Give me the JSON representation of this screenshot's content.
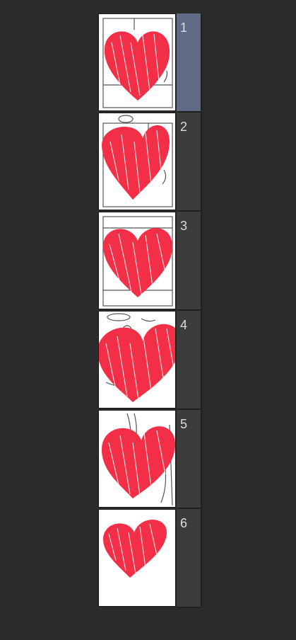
{
  "pages": [
    {
      "number": "1",
      "selected": true,
      "icon": "heart-sketch"
    },
    {
      "number": "2",
      "selected": false,
      "icon": "heart-sketch"
    },
    {
      "number": "3",
      "selected": false,
      "icon": "heart-sketch"
    },
    {
      "number": "4",
      "selected": false,
      "icon": "heart-sketch"
    },
    {
      "number": "5",
      "selected": false,
      "icon": "heart-sketch"
    },
    {
      "number": "6",
      "selected": false,
      "icon": "heart-sketch"
    }
  ],
  "colors": {
    "background": "#2b2b2b",
    "tab": "#3c3c3c",
    "tab_selected": "#5f6a85",
    "heart": "#f22f46",
    "sketch_lines": "#555555"
  }
}
